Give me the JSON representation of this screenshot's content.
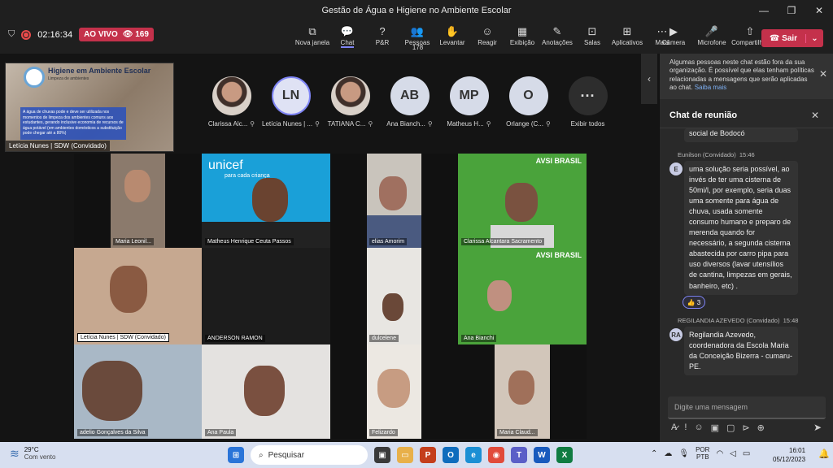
{
  "window": {
    "title": "Gestão de Água e Higiene no Ambiente Escolar",
    "min": "—",
    "max": "❐",
    "close": "✕"
  },
  "toolbar": {
    "timer": "02:16:34",
    "live_label": "AO VIVO",
    "viewers": "169",
    "tools": [
      {
        "icon": "⧉",
        "label": "Nova janela"
      },
      {
        "icon": "💬",
        "label": "Chat"
      },
      {
        "icon": "?",
        "label": "P&R"
      },
      {
        "icon": "👥",
        "label": "Pessoas",
        "badge": "178"
      },
      {
        "icon": "✋",
        "label": "Levantar"
      },
      {
        "icon": "☺",
        "label": "Reagir"
      },
      {
        "icon": "▦",
        "label": "Exibição"
      },
      {
        "icon": "✎",
        "label": "Anotações"
      },
      {
        "icon": "⊡",
        "label": "Salas"
      },
      {
        "icon": "⊞",
        "label": "Aplicativos"
      },
      {
        "icon": "⋯",
        "label": "Mais"
      }
    ],
    "media": [
      {
        "icon": "▶",
        "label": "Câmera"
      },
      {
        "icon": "🎤",
        "label": "Microfone"
      },
      {
        "icon": "⇧",
        "label": "Compartilhar"
      }
    ],
    "leave_label": "Sair",
    "leave_caret": "⌄"
  },
  "share": {
    "title": "Higiene em Ambiente Escolar",
    "subtitle": "Limpeza de ambientes",
    "body": "A água de chuvas pode e deve ser utilizada nos momentos de limpeza dos ambientes comuns aos estudantes, gerando inclusive economia de recursos de água potável (em ambientes domésticos a substituição pode chegar até a 80%)",
    "caption": "Letícia Nunes | SDW (Convidado)"
  },
  "participants": [
    {
      "name": "Clarissa Alc...",
      "initials": "",
      "style": "photo"
    },
    {
      "name": "Letícia Nunes | ...",
      "initials": "LN",
      "style": "ln"
    },
    {
      "name": "TATIANA C...",
      "initials": "",
      "style": "photo"
    },
    {
      "name": "Ana Bianch...",
      "initials": "AB",
      "style": "init"
    },
    {
      "name": "Matheus H...",
      "initials": "MP",
      "style": "init"
    },
    {
      "name": "Orlange (C...",
      "initials": "O",
      "style": "init"
    },
    {
      "name": "Exibir todos",
      "initials": "···",
      "style": "dots"
    }
  ],
  "collapse_icon": "‹",
  "tiles": [
    "Maria Leonil...",
    "Matheus Henrique Ceuta Passos",
    "elias Amorim",
    "Clarissa Alcantara Sacramento",
    "Letícia Nunes | SDW (Convidado)",
    "ANDERSON RAMON",
    "dulcelene",
    "Ana Bianchi",
    "adelio Gonçalves da Silva",
    "Ana Paula",
    "Felizardo",
    "Maria Claud..."
  ],
  "unicef": {
    "logo": "unicef",
    "tagline": "para cada criança"
  },
  "avsi": "AVSI BRASIL",
  "banner": {
    "text": "Algumas pessoas neste chat estão fora da sua organização. É possível que elas tenham políticas relacionadas a mensagens que serão aplicadas ao chat.",
    "link": "Saiba mais"
  },
  "chat": {
    "title": "Chat de reunião",
    "prev_text": "social de Bodocó",
    "m1": {
      "author": "Eunilson (Convidado)",
      "time": "15:46",
      "initial": "E",
      "text": "uma solução seria possível, ao invés de ter uma cisterna de 50mi/l, por exemplo, seria duas uma somente para água de chuva, usada somente consumo humano e preparo de merenda quando for necessário, a segunda cisterna abastecida por carro pipa para uso diversos (lavar utensílios de cantina, limpezas em gerais, banheiro, etc) .",
      "reaction_icon": "👍",
      "reaction_count": "3"
    },
    "m2": {
      "author": "REGILANDIA AZEVEDO (Convidado)",
      "time": "15:48",
      "initial": "RA",
      "text": "Regilandia Azevedo, coordenadora da Escola Maria da Conceição Bizerra - cumaru-PE."
    },
    "placeholder": "Digite uma mensagem"
  },
  "taskbar": {
    "temp": "29°C",
    "weather": "Com vento",
    "search": "Pesquisar",
    "lang1": "POR",
    "lang2": "PTB",
    "time": "16:01",
    "date": "05/12/2023"
  }
}
